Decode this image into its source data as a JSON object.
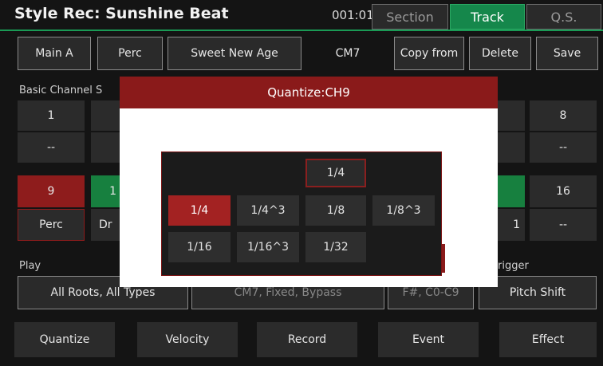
{
  "header": {
    "title": "Style Rec: Sunshine Beat",
    "time": "001:01",
    "tabs": [
      {
        "label": "Section",
        "active": false
      },
      {
        "label": "Track",
        "active": true
      },
      {
        "label": "Q.S.",
        "active": false
      }
    ]
  },
  "toolbar": {
    "main": "Main A",
    "part": "Perc",
    "voice": "Sweet New Age",
    "chord": "CM7",
    "copy_from": "Copy from",
    "delete": "Delete",
    "save": "Save"
  },
  "channels": {
    "section_label": "Basic Channel S",
    "row1_left": {
      "num": "1",
      "val": "--"
    },
    "row1_right": {
      "num": "8",
      "val": "--"
    },
    "row2_left": {
      "num": "9",
      "val": "Perc"
    },
    "row2_left_partial": {
      "num": "1",
      "val": "Dr"
    },
    "row2_right": {
      "num": "16",
      "val": "--"
    },
    "row2_right_partial": "1"
  },
  "play": {
    "label": "Play",
    "retrigger_label": "rigger",
    "buttons": [
      "All Roots, All Types",
      "CM7, Fixed, Bypass",
      "F#, C0-C9",
      "Pitch Shift"
    ]
  },
  "bottom_buttons": [
    "Quantize",
    "Velocity",
    "Record",
    "Event",
    "Effect"
  ],
  "dialog": {
    "title": "Quantize:CH9",
    "current": "1/4",
    "options": [
      "1/4",
      "1/4^3",
      "1/8",
      "1/8^3",
      "1/16",
      "1/16^3",
      "1/32"
    ],
    "selected": "1/4"
  },
  "colors": {
    "accent_green": "#15874b",
    "accent_red": "#a32222",
    "dialog_header": "#8a1a1a"
  }
}
